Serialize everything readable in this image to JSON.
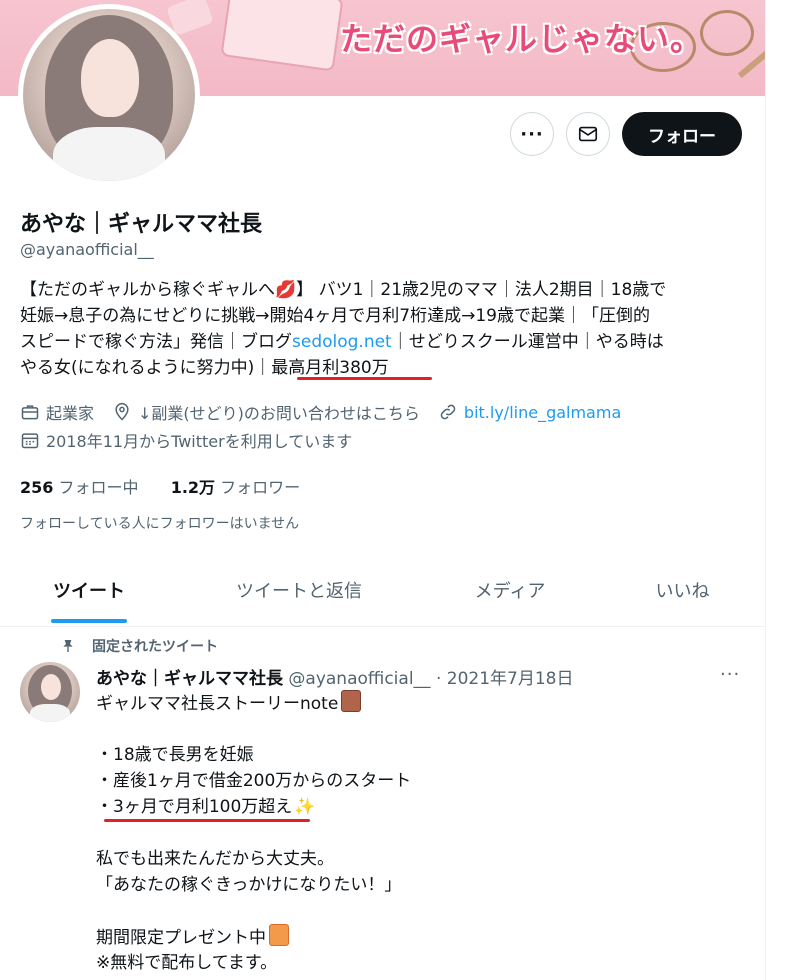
{
  "banner": {
    "title": "ただのギャルじゃない。"
  },
  "actions": {
    "more": "···",
    "follow_label": "フォロー"
  },
  "profile": {
    "display_name": "あやな｜ギャルママ社長",
    "handle": "@ayanaofficial__",
    "bio_lines": [
      "【ただのギャルから稼ぐギャルへ💋】 バツ1｜21歳2児のママ｜法人2期目｜18歳で",
      "妊娠→息子の為にせどりに挑戦→開始4ヶ月で月利7桁達成→19歳で起業｜「圧倒的",
      "スピードで稼ぐ方法」発信｜ブログ",
      "sedolog.net",
      "｜せどりスクール運営中｜やる時は",
      "やる女(になれるように努力中)｜",
      "最高月利380万"
    ],
    "category": "起業家",
    "location": "↓副業(せどり)のお問い合わせはこちら",
    "website": "bit.ly/line_galmama",
    "joined": "2018年11月からTwitterを利用しています",
    "following_count": "256",
    "following_label": "フォロー中",
    "followers_count": "1.2万",
    "followers_label": "フォロワー",
    "followers_note": "フォローしている人にフォロワーはいません"
  },
  "tabs": [
    {
      "label": "ツイート",
      "active": true
    },
    {
      "label": "ツイートと返信",
      "active": false
    },
    {
      "label": "メディア",
      "active": false
    },
    {
      "label": "いいね",
      "active": false
    }
  ],
  "tweet": {
    "pinned_label": "固定されたツイート",
    "author_name": "あやな｜ギャルママ社長",
    "author_handle": "@ayanaofficial__",
    "separator": "·",
    "date": "2021年7月18日",
    "more": "···",
    "lines": [
      "ギャルママ社長ストーリーnote",
      "",
      "・18歳で長男を妊娠",
      "・産後1ヶ月で借金200万からのスタート",
      "・3ヶ月で月利100万超え",
      "",
      "私でも出来たんだから大丈夫。",
      "「あなたの稼ぐきっかけになりたい！」",
      "",
      "期間限定プレゼント中",
      "※無料で配布してます。"
    ]
  },
  "colors": {
    "accent": "#1d9bf0",
    "text": "#0f1419",
    "muted": "#536471",
    "highlight_underline": "#e0202a"
  }
}
